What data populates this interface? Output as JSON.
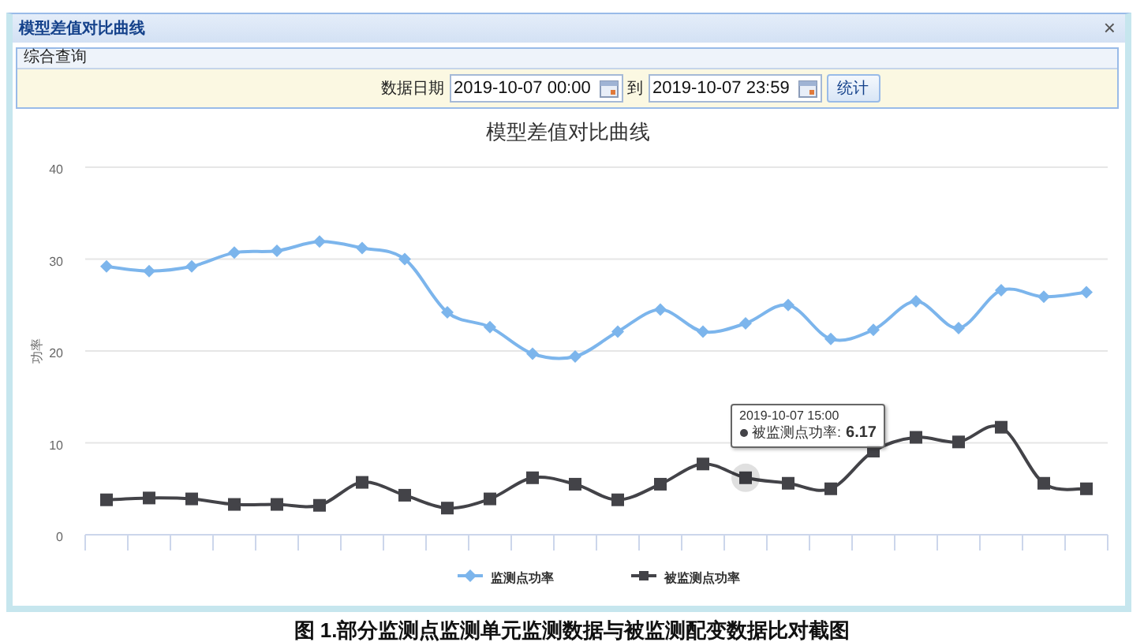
{
  "window": {
    "title": "模型差值对比曲线",
    "close": "×"
  },
  "panel": {
    "title": "综合查询"
  },
  "query": {
    "label": "数据日期",
    "start": "2019-10-07 00:00",
    "separator": "到",
    "end": "2019-10-07 23:59",
    "button": "统计"
  },
  "chart": {
    "chart_data": {
      "type": "line",
      "title": "模型差值对比曲线",
      "ylabel": "功率",
      "ylim": [
        0,
        40
      ],
      "yticks": [
        0,
        10,
        20,
        30,
        40
      ],
      "series": [
        {
          "name": "监测点功率",
          "color": "#7cb5ec",
          "marker": "diamond",
          "values": [
            29.2,
            28.7,
            29.2,
            30.7,
            30.9,
            31.9,
            31.2,
            30.0,
            24.2,
            22.6,
            19.7,
            19.4,
            22.1,
            24.5,
            22.1,
            23.0,
            25.0,
            21.3,
            22.3,
            25.4,
            22.5,
            26.6,
            25.9,
            26.4
          ]
        },
        {
          "name": "被监测点功率",
          "color": "#434348",
          "marker": "square",
          "values": [
            3.8,
            4.0,
            3.9,
            3.3,
            3.3,
            3.2,
            5.7,
            4.3,
            2.9,
            3.9,
            6.2,
            5.5,
            3.8,
            5.5,
            7.7,
            6.2,
            5.6,
            5.0,
            9.1,
            10.6,
            10.1,
            11.7,
            5.6,
            5.0
          ]
        }
      ],
      "grid": true,
      "legend": true
    },
    "tooltip": {
      "title": "2019-10-07 15:00",
      "label": "被监测点功率:",
      "value": "6.17"
    }
  },
  "caption": "图 1.部分监测点监测单元监测数据与被监测配变数据比对截图"
}
